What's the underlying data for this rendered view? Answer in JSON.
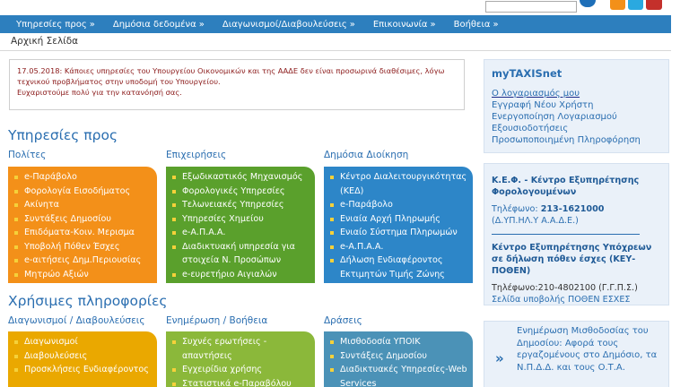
{
  "search": {
    "placeholder": ""
  },
  "social": {
    "rss": "rss-icon",
    "twitter": "twitter-icon",
    "youtube": "youtube-icon"
  },
  "nav": {
    "items": [
      {
        "label": "Υπηρεσίες προς"
      },
      {
        "label": "Δημόσια δεδομένα"
      },
      {
        "label": "Διαγωνισμοί/Διαβουλεύσεις"
      },
      {
        "label": "Επικοινωνία"
      },
      {
        "label": "Βοήθεια"
      }
    ],
    "arrow": "»"
  },
  "breadcrumb": "Αρχική Σελίδα",
  "notice": {
    "line1": "17.05.2018: Κάποιες υπηρεσίες του Υπουργείου Οικονομικών και της ΑΑΔΕ δεν είναι προσωρινά διαθέσιμες, λόγω",
    "line2": "τεχνικού προβλήματος στην υποδομή του Υπουργείου.",
    "line3": "Ευχαριστούμε πολύ για την κατανόησή σας."
  },
  "services": {
    "title": "Υπηρεσίες προς",
    "columns": [
      {
        "heading": "Πολίτες",
        "items": [
          "e-Παράβολο",
          "Φορολογία Εισοδήματος",
          "Ακίνητα",
          "Συντάξεις Δημοσίου",
          "Επιδόματα-Κοιν. Μερισμα",
          "Υποβολή Πόθεν Έσχες",
          "e-αιτήσεις Δημ.Περιουσίας",
          "Μητρώο Αξιών"
        ]
      },
      {
        "heading": "Επιχειρήσεις",
        "items": [
          "Εξωδικαστικός Μηχανισμός",
          "Φορολογικές Υπηρεσίες",
          "Τελωνειακές Υπηρεσίες",
          "Υπηρεσίες Χημείου",
          "e-Α.Π.Α.Α.",
          "Διαδικτυακή υπηρεσία για στοιχεία Ν. Προσώπων",
          "e-ευρετήριο Αιγιαλών"
        ]
      },
      {
        "heading": "Δημόσια Διοίκηση",
        "items": [
          "Κέντρο Διαλειτουργικότητας (ΚΕΔ)",
          "e-Παράβολο",
          "Ενιαία Αρχή Πληρωμής",
          "Ενιαίο Σύστημα Πληρωμών",
          "e-Α.Π.Α.Α.",
          "Δήλωση Ενδιαφέροντος Εκτιμητών Τιμής Ζώνης"
        ]
      }
    ]
  },
  "useful": {
    "title": "Χρήσιμες πληροφορίες",
    "columns": [
      {
        "heading": "Διαγωνισμοί / Διαβουλεύσεις",
        "items": [
          "Διαγωνισμοί",
          "Διαβουλεύσεις",
          "Προσκλήσεις Ενδιαφέροντος"
        ]
      },
      {
        "heading": "Ενημέρωση / Βοήθεια",
        "items": [
          "Συχνές ερωτήσεις - απαντήσεις",
          "Εγχειρίδια χρήσης",
          "Στατιστικά e-Παραβόλου"
        ]
      },
      {
        "heading": "Δράσεις",
        "items": [
          "Μισθοδοσία ΥΠΟΙΚ",
          "Συντάξεις Δημοσίου",
          "Διαδικτυακές Υπηρεσίες-Web Services"
        ]
      }
    ]
  },
  "taxisnet": {
    "title": "myTAXISnet",
    "links": [
      "Ο λογαριασμός μου",
      "Εγγραφή Νέου Χρήστη",
      "Ενεργοποίηση Λογαριασμού",
      "Εξουσιοδοτήσεις",
      "Προσωποποιημένη Πληροφόρηση"
    ]
  },
  "kef": {
    "title1": "Κ.Ε.Φ. - Κέντρο Εξυπηρέτησης Φορολογουμένων",
    "phone1_label": "Τηλέφωνο:",
    "phone1": "213-1621000",
    "phone1_note": "(Δ.ΥΠ.ΗΛ.Υ Α.Α.Δ.Ε.)",
    "title2": "Κέντρο Εξυπηρέτησης Υπόχρεων σε δήλωση πόθεν έσχες (ΚΕΥ-ΠΟΘΕΝ)",
    "phone2": "Τηλέφωνο:210-4802100 (Γ.Γ.Π.Σ.)",
    "link2": "Σελίδα υποβολής ΠΟΘΕΝ ΕΣΧΕΣ"
  },
  "news": {
    "text": "Ενημέρωση Μισθοδοσίας του Δημοσίου: Αφορά τους εργαζομένους στο Δημόσιο, τα Ν.Π.Δ.Δ. και τους Ο.Τ.Α."
  }
}
